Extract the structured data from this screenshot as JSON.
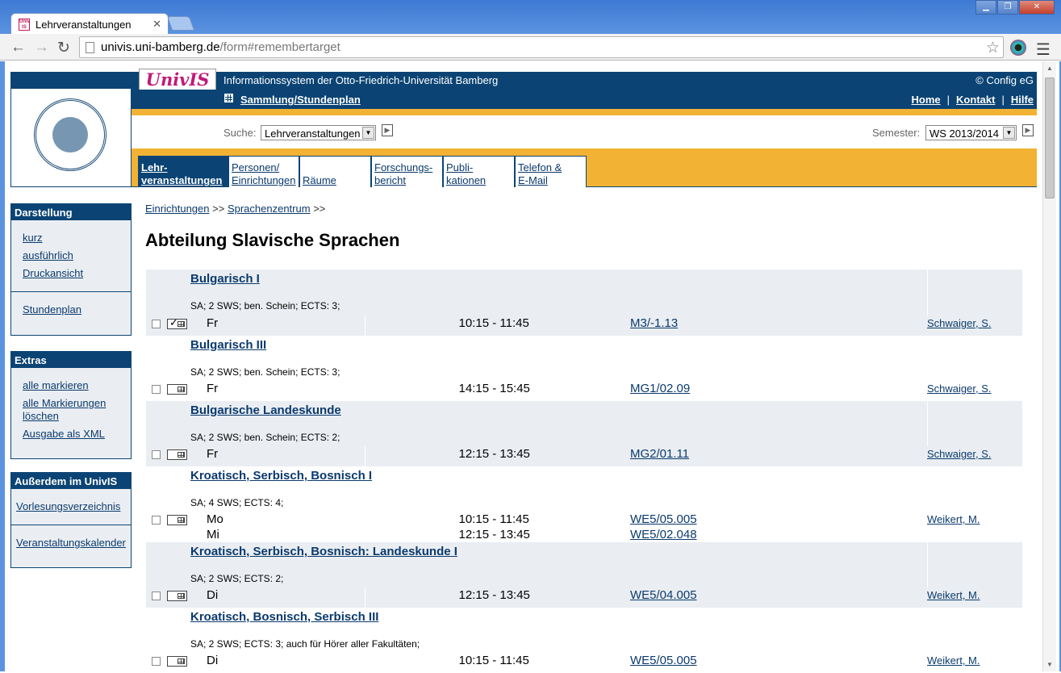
{
  "browser": {
    "tab_title": "Lehrveranstaltungen",
    "url_host": "univis.uni-bamberg.de",
    "url_path": "/form#remembertarget"
  },
  "header": {
    "logo_text": "UnivIS",
    "info_title": "Informationssystem der Otto-Friedrich-Universität Bamberg",
    "copyright": "© Config eG",
    "collection_link": "Sammlung/Stundenplan",
    "top_links": [
      "Home",
      "Kontakt",
      "Hilfe"
    ]
  },
  "search": {
    "label": "Suche:",
    "selected": "Lehrveranstaltungen",
    "semester_label": "Semester:",
    "semester_selected": "WS 2013/2014"
  },
  "nav_tabs": [
    {
      "line1": "Lehr-",
      "line2": "veranstaltungen",
      "active": true
    },
    {
      "line1": "Personen/",
      "line2": "Einrichtungen",
      "active": false
    },
    {
      "line1": "",
      "line2": "Räume",
      "active": false
    },
    {
      "line1": "Forschungs-",
      "line2": "bericht",
      "active": false
    },
    {
      "line1": "Publi-",
      "line2": "kationen",
      "active": false
    },
    {
      "line1": "Telefon &",
      "line2": "E-Mail",
      "active": false
    }
  ],
  "sidebar": {
    "darstellung": {
      "title": "Darstellung",
      "links": [
        "kurz",
        "ausführlich",
        "Druckansicht"
      ],
      "links2": [
        "Stundenplan"
      ]
    },
    "extras": {
      "title": "Extras",
      "links": [
        "alle markieren",
        "alle Markierungen löschen",
        "Ausgabe als XML"
      ]
    },
    "ausserdem": {
      "title": "Außerdem im UnivIS",
      "links": [
        "Vorlesungsverzeichnis"
      ],
      "links2": [
        "Veranstaltungskalender"
      ]
    }
  },
  "breadcrumb": {
    "items": [
      "Einrichtungen",
      "Sprachenzentrum"
    ],
    "sep": ">>"
  },
  "page_title": "Abteilung Slavische Sprachen",
  "courses": [
    {
      "title": "Bulgarisch I",
      "meta": "SA; 2 SWS; ben. Schein; ECTS: 3;",
      "days": [
        "Fr"
      ],
      "times": [
        "10:15 - 11:45"
      ],
      "rooms": [
        "M3/-1.13"
      ],
      "lecturer": "Schwaiger, S.",
      "shaded": true,
      "marked": true
    },
    {
      "title": "Bulgarisch III",
      "meta": "SA; 2 SWS; ben. Schein; ECTS: 3;",
      "days": [
        "Fr"
      ],
      "times": [
        "14:15 - 15:45"
      ],
      "rooms": [
        "MG1/02.09"
      ],
      "lecturer": "Schwaiger, S.",
      "shaded": false,
      "marked": false
    },
    {
      "title": "Bulgarische Landeskunde",
      "meta": "SA; 2 SWS; ben. Schein; ECTS: 2;",
      "days": [
        "Fr"
      ],
      "times": [
        "12:15 - 13:45"
      ],
      "rooms": [
        "MG2/01.11"
      ],
      "lecturer": "Schwaiger, S.",
      "shaded": true,
      "marked": false
    },
    {
      "title": "Kroatisch, Serbisch, Bosnisch I",
      "meta": "SA; 4 SWS; ECTS: 4;",
      "days": [
        "Mo",
        "Mi"
      ],
      "times": [
        "10:15 - 11:45",
        "12:15 - 13:45"
      ],
      "rooms": [
        "WE5/05.005",
        "WE5/02.048"
      ],
      "lecturer": "Weikert, M.",
      "shaded": false,
      "marked": false
    },
    {
      "title": "Kroatisch, Serbisch, Bosnisch: Landeskunde I",
      "meta": "SA; 2 SWS; ECTS: 2;",
      "days": [
        "Di"
      ],
      "times": [
        "12:15 - 13:45"
      ],
      "rooms": [
        "WE5/04.005"
      ],
      "lecturer": "Weikert, M.",
      "shaded": true,
      "marked": false
    },
    {
      "title": "Kroatisch, Bosnisch, Serbisch III",
      "meta": "SA; 2 SWS; ECTS: 3; auch für Hörer aller Fakultäten;",
      "days": [
        "Di"
      ],
      "times": [
        "10:15 - 11:45"
      ],
      "rooms": [
        "WE5/05.005"
      ],
      "lecturer": "Weikert, M.",
      "shaded": false,
      "marked": false
    }
  ]
}
